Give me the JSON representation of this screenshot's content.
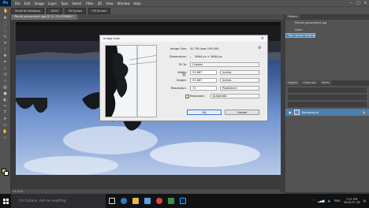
{
  "app": {
    "logo": "Ps"
  },
  "menu": [
    "File",
    "Edit",
    "Image",
    "Layer",
    "Type",
    "Select",
    "Filter",
    "3D",
    "View",
    "Window",
    "Help"
  ],
  "options_bar": [
    "Scroll All Windows",
    "100%",
    "Fit Screen",
    "Fill Screen"
  ],
  "document_tab": "Planet_panorama1.jpg @ 11.1% (RGB/8) *",
  "status_bar": "11.11%",
  "history_panel": {
    "tabs": [
      "History"
    ],
    "items": [
      "Planet_panorama1.jpg",
      "Open",
      "Flip Canvas Vertical"
    ]
  },
  "layers_panel": {
    "tabs": [
      "Layers",
      "Channels",
      "Paths"
    ],
    "layer": "Background"
  },
  "dialog": {
    "title": "Image Size",
    "image_size_label": "Image Size:",
    "image_size_value": "42.7M (was 199.0M)",
    "dimensions_label": "Dimensions:",
    "dimensions_value": "3864 px × 3864 px",
    "fit_to_label": "Fit To:",
    "fit_to_value": "Custom",
    "width_label": "Width:",
    "width_value": "53.667",
    "width_unit": "Inches",
    "height_label": "Height:",
    "height_value": "53.667",
    "height_unit": "Inches",
    "resolution_label": "Resolution:",
    "resolution_value": "72",
    "resolution_unit": "Pixels/Inch",
    "resample_label": "Resample:",
    "resample_value": "Automatic",
    "ok": "OK",
    "cancel": "Cancel"
  },
  "taskbar": {
    "search_placeholder": "I'm Cortana. Ask me anything.",
    "time": "7:21 PM",
    "date": "2016-07-18",
    "lang": "ENG"
  }
}
